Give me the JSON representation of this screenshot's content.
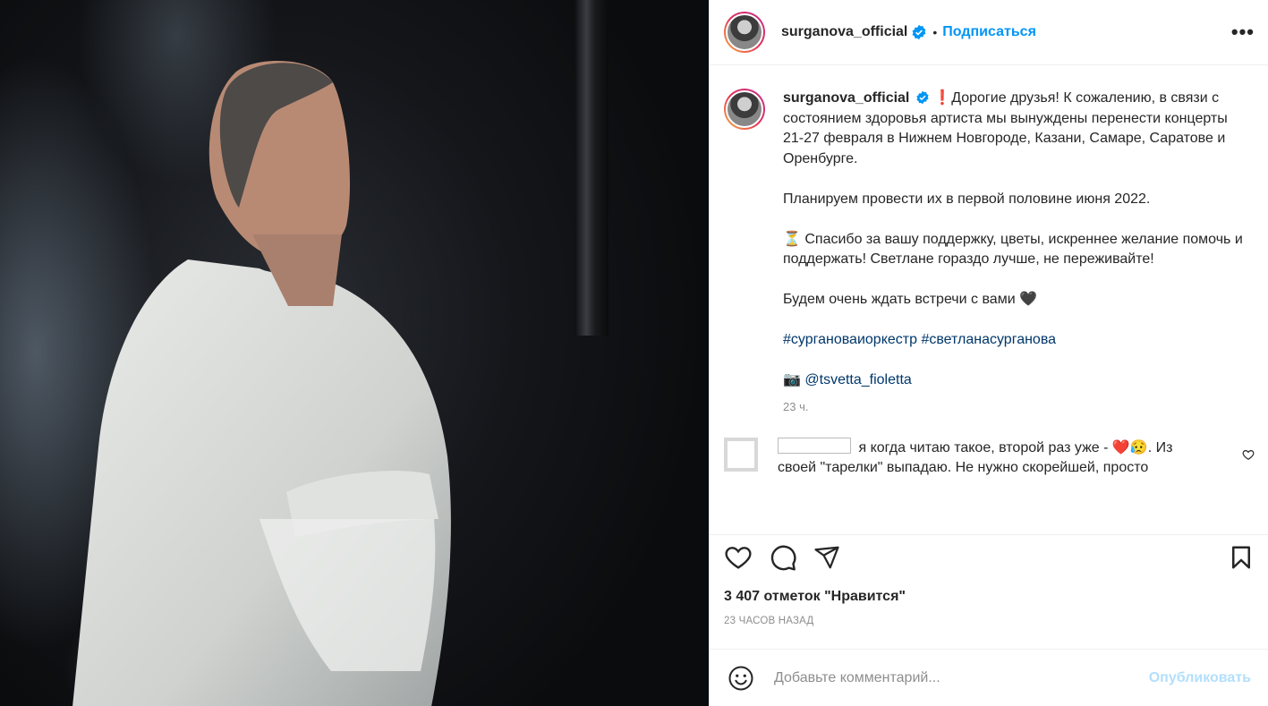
{
  "post": {
    "username": "surganova_official",
    "follow_label": "Подписаться",
    "dot": "•",
    "more_label": "•••"
  },
  "caption": {
    "username": "surganova_official",
    "p1": "❗Дорогие друзья! К сожалению, в связи с состоянием здоровья артиста мы вынуждены перенести концерты 21-27 февраля в Нижнем Новгороде, Казани, Самаре, Саратове и Оренбурге.",
    "p2": "Планируем провести их в первой половине июня 2022.",
    "p3": "⏳ Спасибо за вашу поддержку, цветы, искреннее желание помочь и поддержать! Светлане гораздо лучше, не переживайте!",
    "p4": "Будем очень ждать встречи с вами 🖤",
    "hashtag1": "#сургановаиоркестр",
    "hashtag2": "#светланасурганова",
    "camera": "📷",
    "mention": "@tsvetta_fioletta",
    "time": "23 ч."
  },
  "comment": {
    "text": "я когда читаю такое, второй раз уже - ❤️😥. Из своей \"тарелки\" выпадаю. Не нужно скорейшей, просто"
  },
  "likes": "3 407 отметок \"Нравится\"",
  "ago": "23 ЧАСОВ НАЗАД",
  "add_comment": {
    "placeholder": "Добавьте комментарий...",
    "publish_label": "Опубликовать"
  },
  "colors": {
    "accent": "#0095f6",
    "hashtag": "#00376b",
    "muted": "#8e8e8e"
  },
  "icons": [
    "heart-icon",
    "comment-icon",
    "share-icon",
    "bookmark-icon",
    "emoji-icon",
    "verified-icon"
  ]
}
